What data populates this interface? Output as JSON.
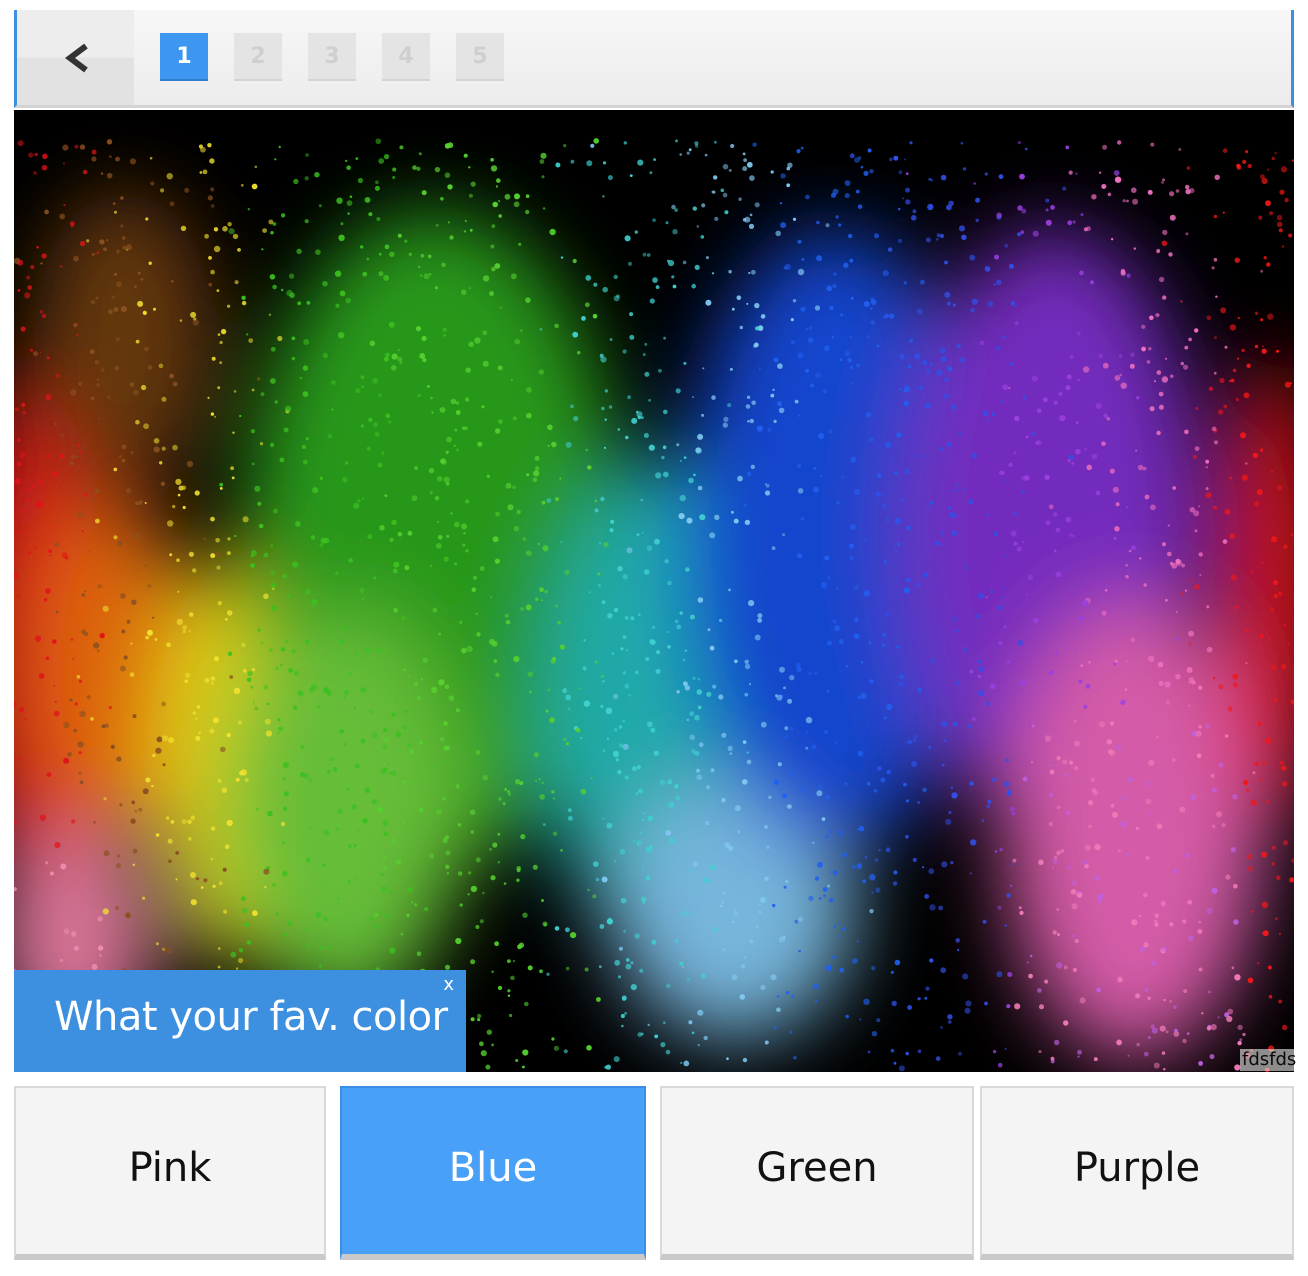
{
  "nav": {
    "back_icon": "chevron-left-icon",
    "pages": [
      {
        "label": "1",
        "active": true
      },
      {
        "label": "2",
        "active": false
      },
      {
        "label": "3",
        "active": false
      },
      {
        "label": "4",
        "active": false
      },
      {
        "label": "5",
        "active": false
      }
    ]
  },
  "question": {
    "text": "What your fav. color",
    "close_label": "x"
  },
  "image": {
    "watermark": "fdsfds"
  },
  "answers": [
    {
      "label": "Pink",
      "selected": false
    },
    {
      "label": "Blue",
      "selected": true
    },
    {
      "label": "Green",
      "selected": false
    },
    {
      "label": "Purple",
      "selected": false
    }
  ],
  "colors": {
    "accent": "#3d8fdf",
    "selected_answer": "#48a0f8",
    "button_bg": "#f4f4f4"
  }
}
